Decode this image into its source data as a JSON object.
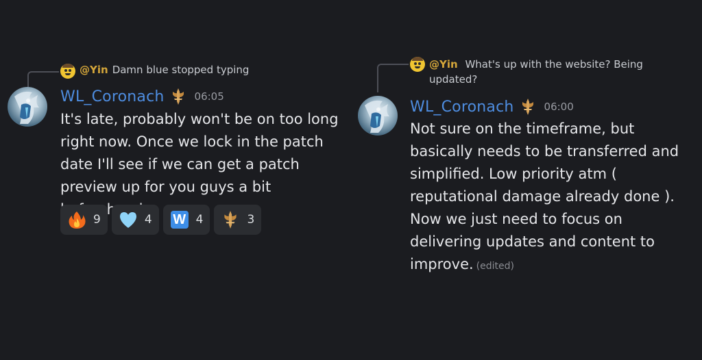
{
  "colors": {
    "background": "#1b1c20",
    "username": "#4e8de0",
    "reply_user": "#d4a63a",
    "reaction_bg": "#2b2d31"
  },
  "messages": [
    {
      "reply": {
        "user": "@Yin",
        "text": "Damn blue stopped typing",
        "avatar_icon": "yin-avatar-icon"
      },
      "author": "WL_Coronach",
      "role_icon": "sword-emblem-icon",
      "timestamp": "06:05",
      "body": "It's late, probably won't be on too long right now. Once we lock in the patch date I'll see if we can get a patch preview up for you guys a bit beforehand.",
      "reactions": [
        {
          "icon": "fire-icon",
          "count": "9"
        },
        {
          "icon": "light-blue-heart-icon",
          "count": "4"
        },
        {
          "icon": "w-emoji-icon",
          "label": "W",
          "count": "4"
        },
        {
          "icon": "sword-emblem-icon",
          "count": "3"
        }
      ]
    },
    {
      "reply": {
        "user": "@Yin",
        "text": "What's up with the website? Being updated?",
        "avatar_icon": "yin-avatar-icon"
      },
      "author": "WL_Coronach",
      "role_icon": "sword-emblem-icon",
      "timestamp": "06:00",
      "body": "Not sure on the timeframe, but basically needs to be transferred and simplified. Low priority atm ( reputational damage already done ). Now we just need to focus on delivering updates and content to improve.",
      "edited": "(edited)"
    }
  ]
}
